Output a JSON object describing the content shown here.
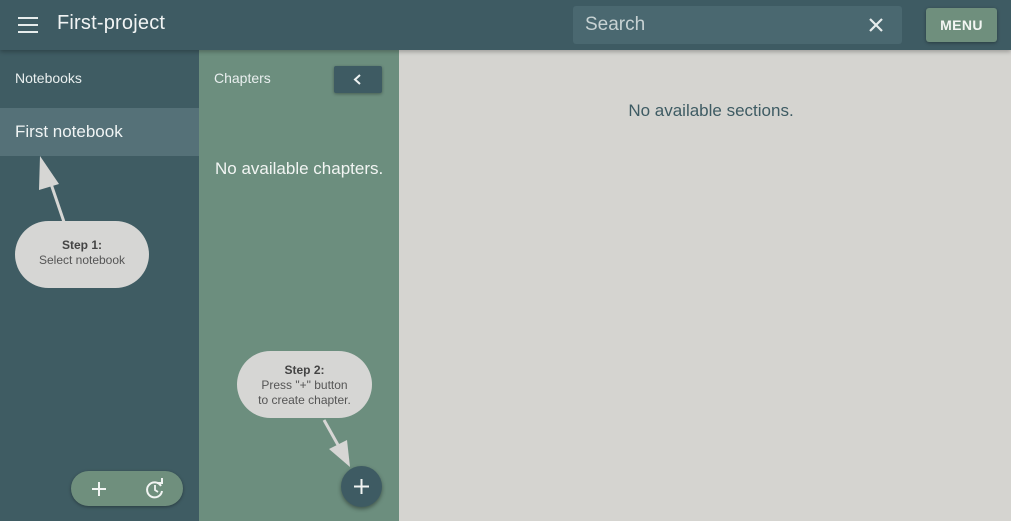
{
  "header": {
    "title": "First-project",
    "search_placeholder": "Search",
    "menu_label": "MENU"
  },
  "notebooks": {
    "heading": "Notebooks",
    "items": [
      {
        "label": "First notebook"
      }
    ],
    "hint": {
      "step": "Step 1:",
      "text": "Select notebook"
    }
  },
  "chapters": {
    "heading": "Chapters",
    "empty_text": "No available chapters.",
    "hint": {
      "step": "Step 2:",
      "line1": "Press \"+\" button",
      "line2": "to create chapter."
    }
  },
  "sections": {
    "empty_text": "No available sections."
  },
  "icons": {
    "menu": "hamburger-icon",
    "clear": "close-icon",
    "collapse": "chevron-left-icon",
    "add": "plus-icon",
    "history": "refresh-icon"
  },
  "colors": {
    "header": "#3e5b63",
    "notebooks_panel": "#3f5c63",
    "selected_item": "#557178",
    "chapters_panel": "#6c8e7e",
    "content_bg": "#d5d4d0",
    "accent_button": "#6f8f7d"
  }
}
